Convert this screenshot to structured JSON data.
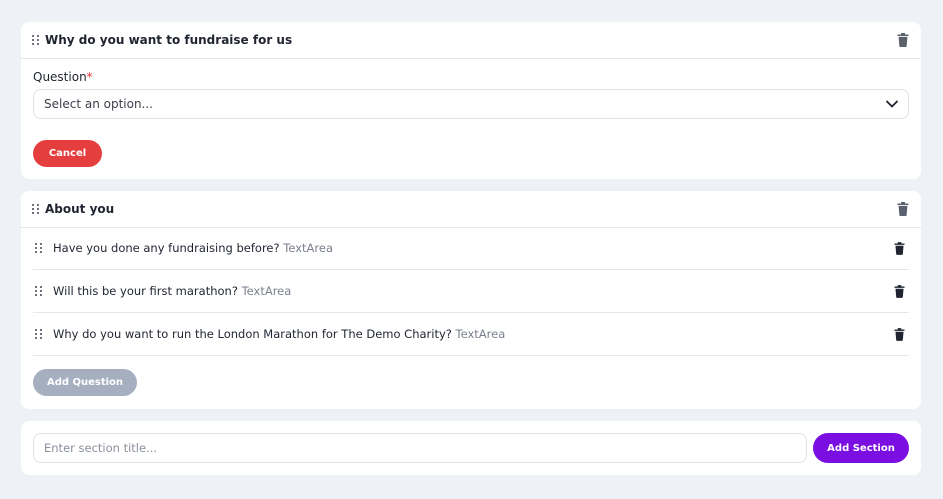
{
  "sections": [
    {
      "title": "Why do you want to fundraise for us",
      "question_label": "Question",
      "required_marker": "*",
      "select": {
        "value": "Select an option..."
      },
      "cancel_label": "Cancel"
    },
    {
      "title": "About you",
      "questions": [
        {
          "text": "Have you done any fundraising before?",
          "type": "TextArea"
        },
        {
          "text": "Will this be your first marathon?",
          "type": "TextArea"
        },
        {
          "text": "Why do you want to run the London Marathon for The Demo Charity?",
          "type": "TextArea"
        }
      ],
      "add_question_label": "Add Question"
    }
  ],
  "new_section": {
    "placeholder": "Enter section title...",
    "add_label": "Add Section"
  },
  "colors": {
    "accent": "#7b0ee0",
    "danger": "#e53e3e",
    "disabled": "#a5afbf",
    "background": "#eef2f6"
  },
  "icons": {
    "drag": "drag-handle-icon",
    "delete": "trash-icon",
    "dropdown": "chevron-down-icon"
  }
}
